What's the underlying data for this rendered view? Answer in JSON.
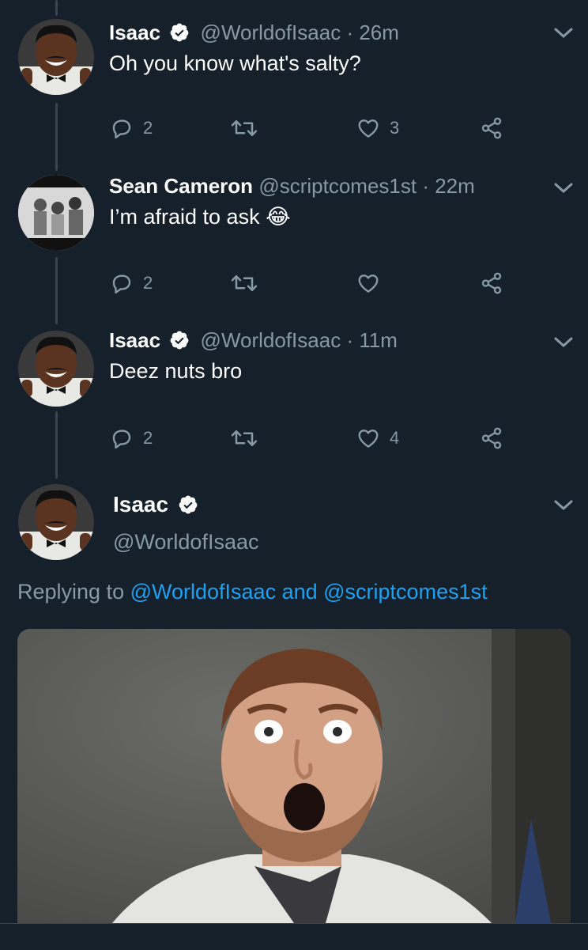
{
  "tweets": [
    {
      "name": "Isaac",
      "handle": "@WorldofIsaac",
      "time": "· 26m",
      "text": "Oh you know what's salty?",
      "replies": "2",
      "retweets": "",
      "likes": "3",
      "verified": true
    },
    {
      "name": "Sean Cameron",
      "handle": "@scriptcomes1st",
      "time": "· 22m",
      "text": "I’m afraid to ask 😂",
      "replies": "2",
      "retweets": "",
      "likes": "",
      "verified": false
    },
    {
      "name": "Isaac",
      "handle": "@WorldofIsaac",
      "time": "· 11m",
      "text": "Deez nuts bro",
      "replies": "2",
      "retweets": "",
      "likes": "4",
      "verified": true
    }
  ],
  "focused": {
    "name": "Isaac",
    "handle": "@WorldofIsaac",
    "replying_prefix": "Replying to ",
    "mention_1": "@WorldofIsaac",
    "conjunction": " and ",
    "mention_2": "@scriptcomes1st"
  },
  "colors": {
    "background": "#15202b",
    "secondary_text": "#8899a6",
    "link": "#1da1f2",
    "thread_line": "#38444d"
  },
  "icons": [
    "verified-badge-icon",
    "chevron-down-icon",
    "reply-icon",
    "retweet-icon",
    "like-icon",
    "share-icon"
  ]
}
